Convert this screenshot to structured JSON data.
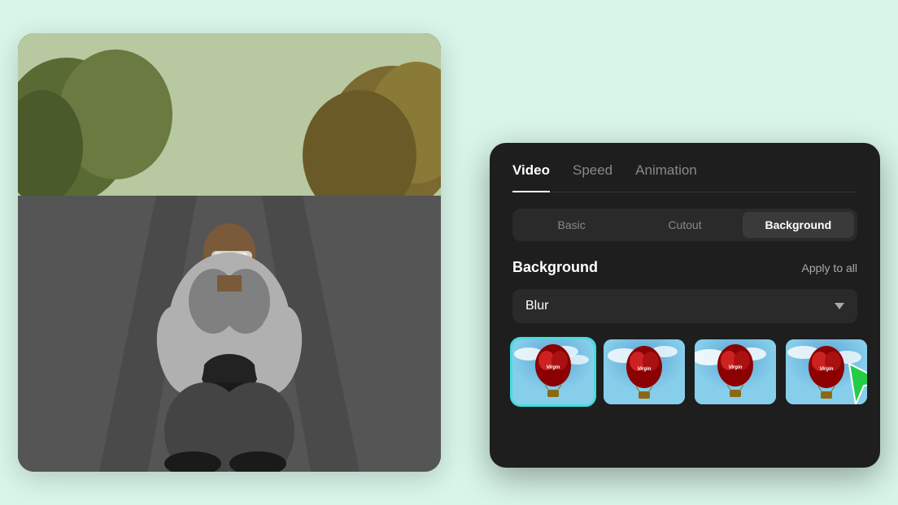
{
  "app": {
    "bg_color": "#d8f5e8"
  },
  "tabs": {
    "items": [
      {
        "label": "Video",
        "active": true
      },
      {
        "label": "Speed",
        "active": false
      },
      {
        "label": "Animation",
        "active": false
      }
    ]
  },
  "sub_tabs": {
    "items": [
      {
        "label": "Basic",
        "active": false
      },
      {
        "label": "Cutout",
        "active": false
      },
      {
        "label": "Background",
        "active": true
      }
    ]
  },
  "section": {
    "title": "Background",
    "apply_all_label": "Apply to all"
  },
  "dropdown": {
    "label": "Blur",
    "chevron": "▾"
  },
  "thumbnails": {
    "items": [
      {
        "id": 1,
        "selected": true,
        "alt": "Hot air balloon 1"
      },
      {
        "id": 2,
        "selected": false,
        "alt": "Hot air balloon 2"
      },
      {
        "id": 3,
        "selected": false,
        "alt": "Hot air balloon 3"
      },
      {
        "id": 4,
        "selected": false,
        "alt": "Hot air balloon 4"
      }
    ]
  },
  "cursor": {
    "color": "#22cc44"
  }
}
